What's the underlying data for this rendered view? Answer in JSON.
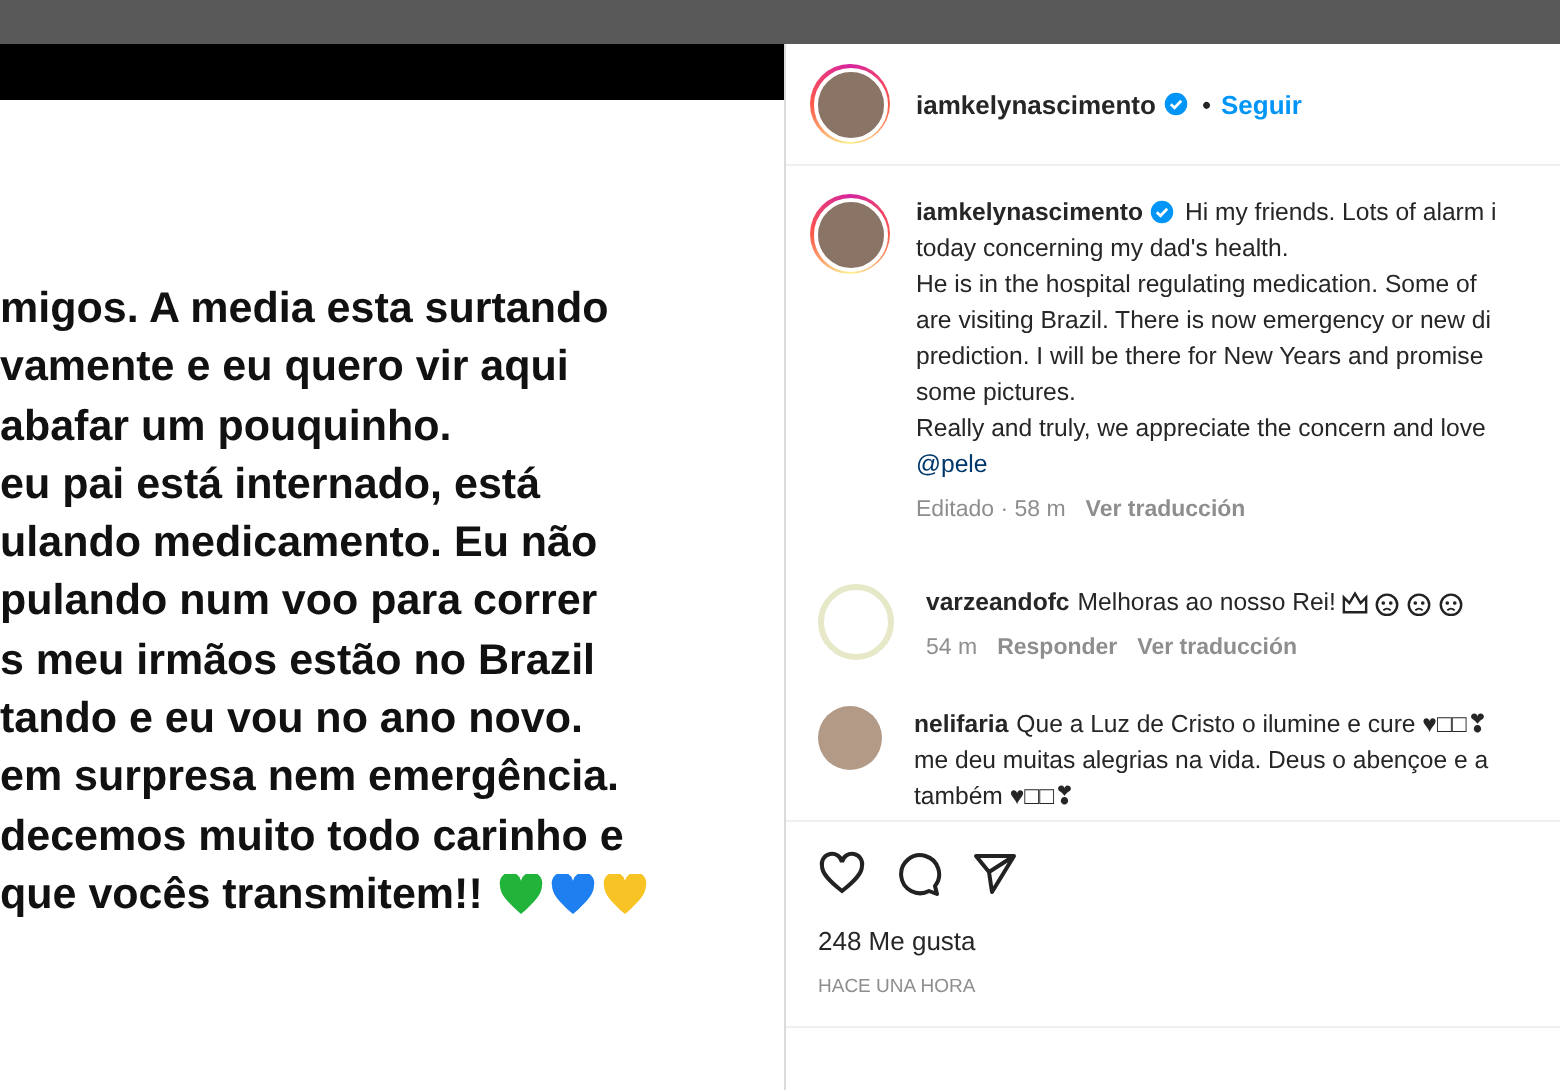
{
  "post_image": {
    "lines": [
      "migos. A media esta surtando",
      "vamente e eu quero vir aqui",
      "abafar um pouquinho.",
      "eu pai está internado, está",
      "ulando medicamento. Eu não",
      "pulando num voo para correr",
      "s meu irmãos estão no Brazil",
      "tando e eu vou no ano novo.",
      "em surpresa nem emergência.",
      "decemos muito todo carinho e",
      "que vocês transmitem!!"
    ]
  },
  "header": {
    "username": "iamkelynascimento",
    "verified": true,
    "separator": "•",
    "follow": "Seguir"
  },
  "caption": {
    "username": "iamkelynascimento",
    "verified": true,
    "first_line": "Hi my friends. Lots of alarm i",
    "lines": [
      "today concerning my dad's health.",
      "He is in the hospital regulating medication. Some of",
      "are visiting Brazil. There is now emergency or new di",
      "prediction. I will be there for New Years and promise",
      "some pictures.",
      "Really and truly, we appreciate the concern and love"
    ],
    "mention": "@pele",
    "meta": "Editado · 58 m",
    "translate": "Ver traducción"
  },
  "comments": [
    {
      "kind": "emoji",
      "username": "varzeandofc",
      "lines": [
        "Melhoras ao nosso Rei!"
      ],
      "time": "54 m",
      "reply": "Responder",
      "translate": "Ver traducción"
    },
    {
      "kind": "plain",
      "username": "nelifaria",
      "lines": [
        "Que a Luz de Cristo o ilumine e cure ♥□□❣",
        "me deu muitas alegrias na vida. Deus o abençoe e a",
        "também ♥□□❣"
      ]
    }
  ],
  "likes": "248 Me gusta",
  "timestamp": "HACE UNA HORA"
}
